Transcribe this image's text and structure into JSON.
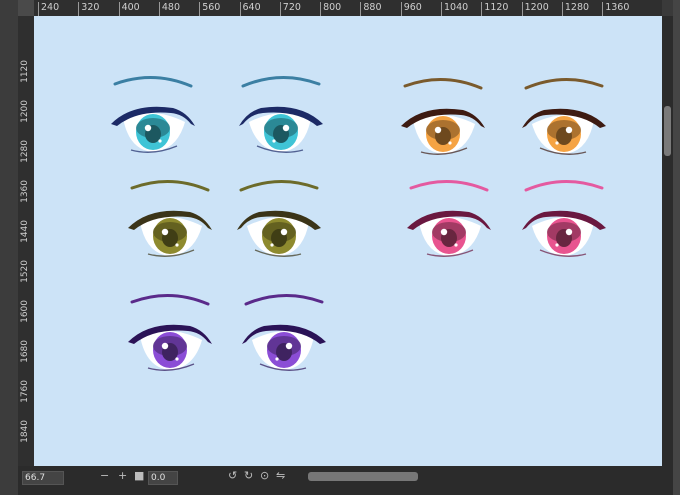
{
  "ruler_top": [
    "240",
    "320",
    "400",
    "480",
    "560",
    "640",
    "720",
    "800",
    "880",
    "960",
    "1040",
    "1120",
    "1200",
    "1280",
    "1360"
  ],
  "ruler_left": [
    "1120",
    "1200",
    "1280",
    "1360",
    "1440",
    "1520",
    "1600",
    "1680",
    "1760",
    "1840"
  ],
  "status": {
    "zoom": "66.7",
    "angle": "0.0"
  },
  "icons": [
    "zoom-out-icon",
    "zoom-in-icon",
    "fit-icon",
    "rotate-left-icon",
    "rotate-right-icon",
    "reset-icon",
    "flip-icon"
  ],
  "eye_colors": {
    "teal": "#3fc4d6",
    "orange": "#f5a343",
    "olive": "#8e8a2e",
    "pink": "#e8548f",
    "purple": "#8b4dd6"
  }
}
